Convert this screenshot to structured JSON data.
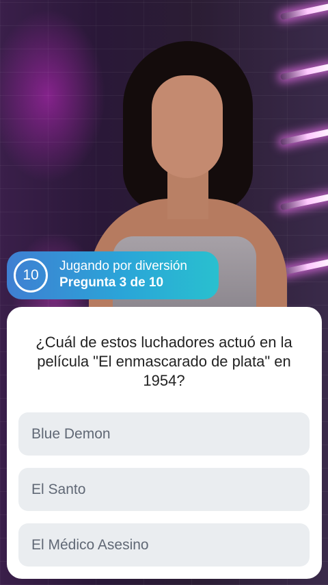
{
  "status": {
    "timer_value": "10",
    "mode_label": "Jugando por diversión",
    "progress_label": "Pregunta 3 de 10"
  },
  "question": {
    "text": "¿Cuál de estos luchadores actuó en la película \"El enmascarado de plata\" en 1954?"
  },
  "answers": [
    {
      "label": "Blue Demon"
    },
    {
      "label": "El Santo"
    },
    {
      "label": "El Médico Asesino"
    }
  ],
  "colors": {
    "pill_gradient_start": "#3f7fd2",
    "pill_gradient_end": "#29c0cf",
    "card_background": "#ffffff",
    "answer_background": "#eaedf0",
    "answer_text": "#606875",
    "question_text": "#222222"
  }
}
